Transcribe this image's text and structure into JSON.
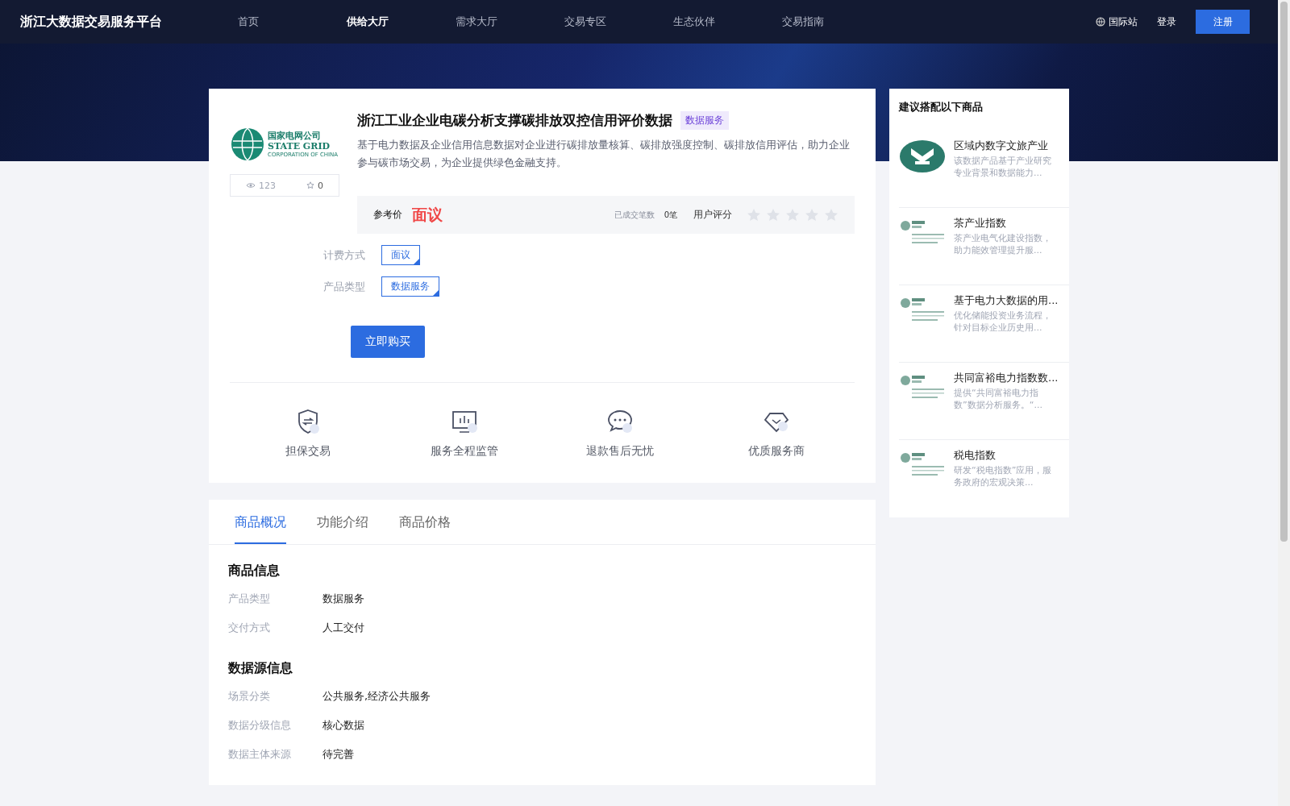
{
  "header": {
    "site_title": "浙江大数据交易服务平台",
    "nav": [
      {
        "label": "首页",
        "selected": false
      },
      {
        "label": "供给大厅",
        "selected": true
      },
      {
        "label": "需求大厅",
        "selected": false
      },
      {
        "label": "交易专区",
        "selected": false
      },
      {
        "label": "生态伙伴",
        "selected": false
      },
      {
        "label": "交易指南",
        "selected": false
      }
    ],
    "intl_link": "国际站",
    "login": "登录",
    "register": "注册"
  },
  "product": {
    "logo_text": [
      "国家电网公司",
      "STATE GRID",
      "CORPORATION OF CHINA"
    ],
    "views": "123",
    "favorites": "0",
    "title": "浙江工业企业电碳分析支撑碳排放双控信用评价数据",
    "badge": "数据服务",
    "description": "基于电力数据及企业信用信息数据对企业进行碳排放量核算、碳排放强度控制、碳排放信用评估，助力企业参与碳市场交易，为企业提供绿色金融支持。",
    "price_label": "参考价",
    "price": "面议",
    "deals_label": "已成交笔数",
    "deals": "0笔",
    "rating_label": "用户评分",
    "stars": 0,
    "options": [
      {
        "label": "计费方式",
        "tags": [
          {
            "text": "面议",
            "selected": true
          }
        ]
      },
      {
        "label": "产品类型",
        "tags": [
          {
            "text": "数据服务",
            "selected": true
          }
        ]
      }
    ],
    "buy_button": "立即购买",
    "features": [
      {
        "kind": "shield",
        "label": "担保交易"
      },
      {
        "kind": "monitor",
        "label": "服务全程监管"
      },
      {
        "kind": "chat",
        "label": "退款售后无忧"
      },
      {
        "kind": "diamond",
        "label": "优质服务商"
      }
    ]
  },
  "details": {
    "tabs": [
      {
        "label": "商品概况",
        "selected": true
      },
      {
        "label": "功能介绍",
        "selected": false
      },
      {
        "label": "商品价格",
        "selected": false
      }
    ],
    "sections": [
      {
        "title": "商品信息",
        "rows": [
          {
            "label": "产品类型",
            "value": "数据服务"
          },
          {
            "label": "交付方式",
            "value": "人工交付"
          }
        ]
      },
      {
        "title": "数据源信息",
        "rows": [
          {
            "label": "场景分类",
            "value": "公共服务,经济公共服务"
          },
          {
            "label": "数据分级信息",
            "value": "核心数据"
          },
          {
            "label": "数据主体来源",
            "value": "待完善"
          }
        ]
      }
    ]
  },
  "sidebar": {
    "title": "建议搭配以下商品",
    "items": [
      {
        "kind": "round-logo",
        "title": "区域内数字文旅产业",
        "description": "该数据产品基于产业研究专业背景和数据能力..."
      },
      {
        "kind": "grid-logo",
        "title": "茶产业指数",
        "description": "茶产业电气化建设指数，助力能效管理提升服..."
      },
      {
        "kind": "grid-logo",
        "title": "基于电力大数据的用...",
        "description": "优化储能投资业务流程，针对目标企业历史用..."
      },
      {
        "kind": "grid-logo",
        "title": "共同富裕电力指数数...",
        "description": "提供“共同富裕电力指数”数据分析服务。“..."
      },
      {
        "kind": "grid-logo",
        "title": "税电指数",
        "description": "研发“税电指数”应用，服务政府的宏观决策..."
      }
    ]
  }
}
